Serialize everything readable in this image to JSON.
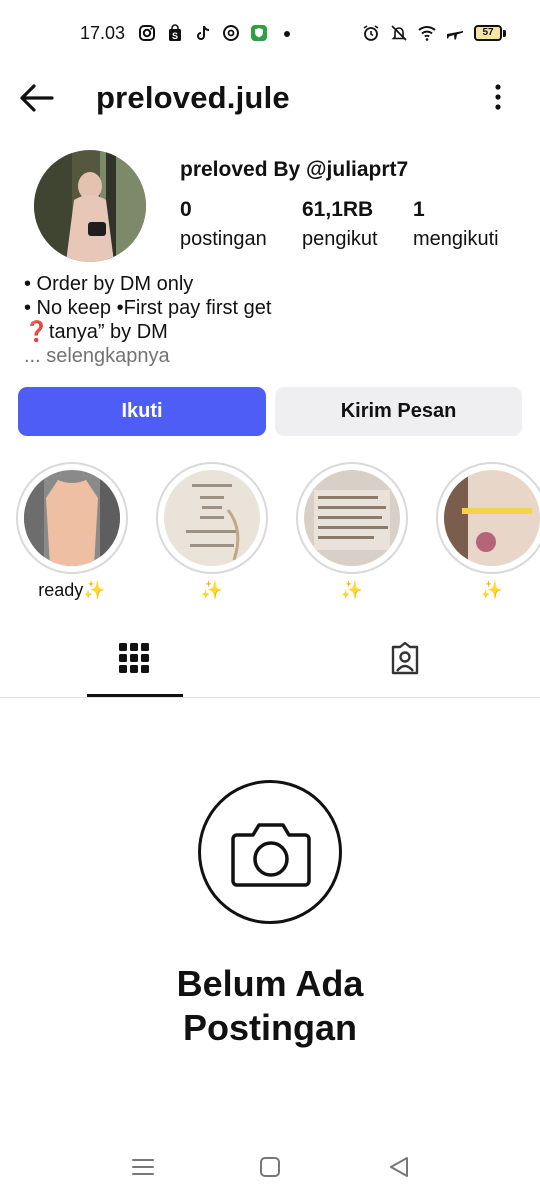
{
  "status_bar": {
    "time": "17.03",
    "left_icons": [
      "instagram-icon",
      "shop-icon",
      "tiktok-icon",
      "threads-icon",
      "shield-app-icon",
      "dot-icon"
    ],
    "right_icons": [
      "alarm-icon",
      "mute-icon",
      "wifi-icon",
      "airplane-icon"
    ],
    "battery": "57"
  },
  "header": {
    "title": "preloved.jule"
  },
  "profile": {
    "display_name": "preloved By ",
    "threads_handle": "juliaprt7",
    "stats": [
      {
        "value": "0",
        "label": "postingan"
      },
      {
        "value": "61,1RB",
        "label": "pengikut"
      },
      {
        "value": "1",
        "label": "mengikuti"
      }
    ],
    "bio": [
      "• Order by DM only",
      "• No keep •First pay first get",
      "❓tanya” by DM"
    ],
    "bio_more": "... selengkapnya"
  },
  "actions": {
    "follow": "Ikuti",
    "message": "Kirim Pesan"
  },
  "highlights": [
    {
      "label": "ready✨"
    },
    {
      "label": "✨"
    },
    {
      "label": "✨"
    },
    {
      "label": "✨"
    }
  ],
  "empty_state": {
    "title_line1": "Belum Ada",
    "title_line2": "Postingan"
  },
  "colors": {
    "follow_button": "#4d5df6",
    "message_button": "#efeff2",
    "muted_text": "#737373"
  }
}
